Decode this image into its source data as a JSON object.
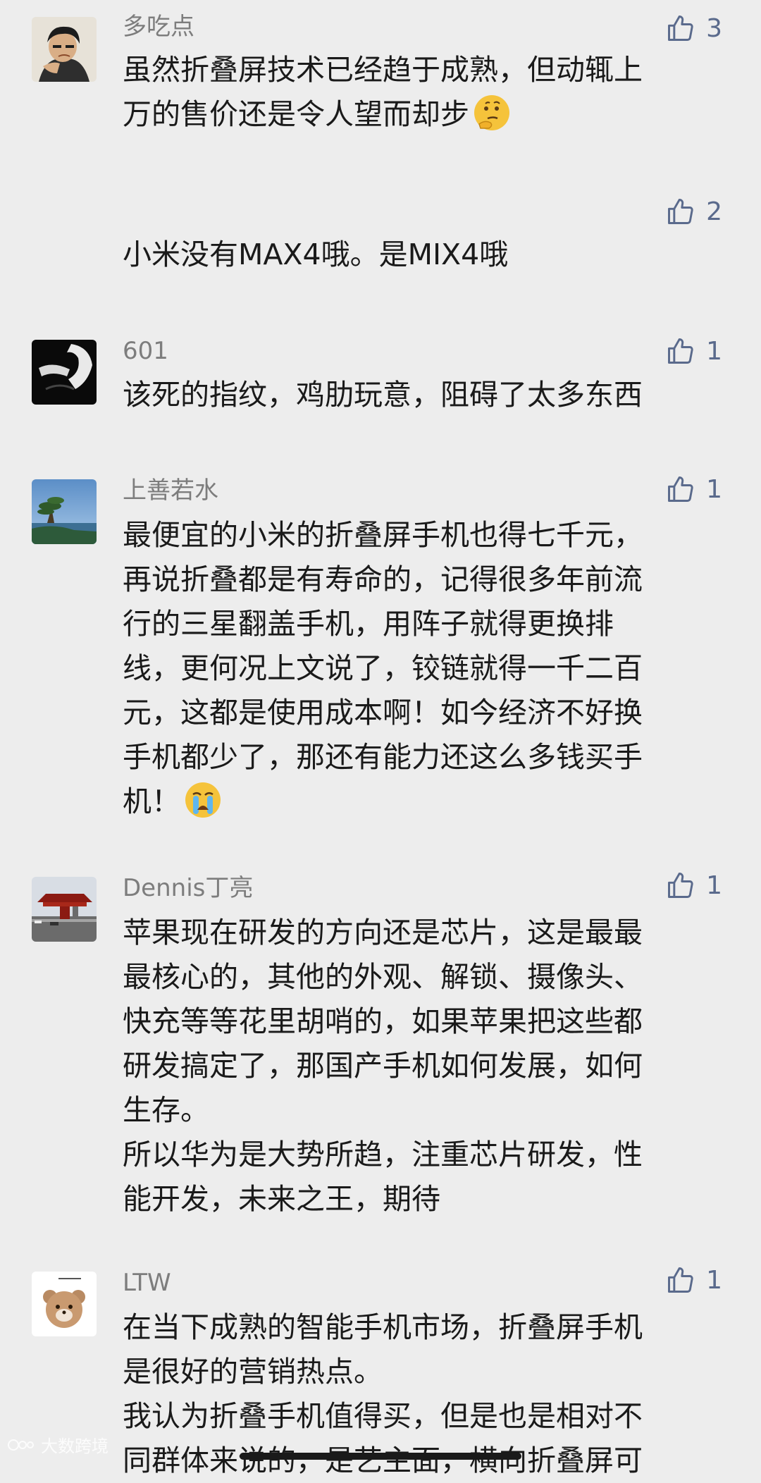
{
  "comments": [
    {
      "username": "多吃点",
      "likes": "3",
      "text": "虽然折叠屏技术已经趋于成熟，但动辄上\n万的售价还是令人望而却步",
      "emoji": "thinking-face-icon"
    },
    {
      "username": "",
      "likes": "2",
      "text": "小米没有MAX4哦。是MIX4哦"
    },
    {
      "username": "601",
      "likes": "1",
      "text": "该死的指纹，鸡肋玩意，阻碍了太多东西"
    },
    {
      "username": "上善若水",
      "likes": "1",
      "text": "最便宜的小米的折叠屏手机也得七千元，\n再说折叠都是有寿命的，记得很多年前流\n行的三星翻盖手机，用阵子就得更换排\n线，更何况上文说了，铰链就得一千二百\n元，这都是使用成本啊！如今经济不好换\n手机都少了，那还有能力还这么多钱买手\n机！",
      "emoji": "crying-face-icon"
    },
    {
      "username": "Dennis丁亮",
      "likes": "1",
      "text": "苹果现在研发的方向还是芯片，这是最最\n最核心的，其他的外观、解锁、摄像头、\n快充等等花里胡哨的，如果苹果把这些都\n研发搞定了，那国产手机如何发展，如何\n生存。\n所以华为是大势所趋，注重芯片研发，性\n能开发，未来之王，期待"
    },
    {
      "username": "LTW",
      "likes": "1",
      "text": "在当下成熟的智能手机市场，折叠屏手机\n是很好的营销热点。\n我认为折叠手机值得买，但是也是相对不\n同群体来说的，是艺主面，横向折叠屏可"
    }
  ],
  "watermark": "大数跨境"
}
